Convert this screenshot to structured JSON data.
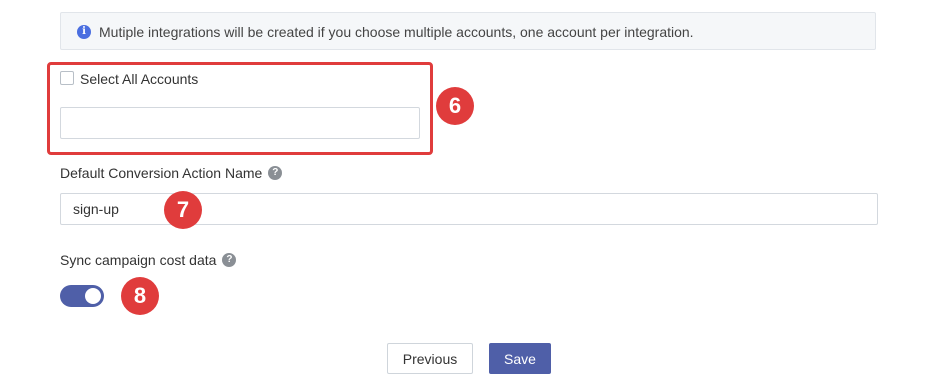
{
  "info_banner": {
    "icon": "info-icon",
    "icon_glyph": "i",
    "text": "Mutiple integrations will be created if you choose multiple accounts, one account per integration."
  },
  "accounts": {
    "select_all_label": "Select All Accounts",
    "select_all_checked": false,
    "input_value": "",
    "marker": "6"
  },
  "conversion": {
    "label": "Default Conversion Action Name",
    "help_glyph": "?",
    "value": "sign-up",
    "marker": "7"
  },
  "sync_cost": {
    "label": "Sync campaign cost data",
    "help_glyph": "?",
    "enabled": true,
    "marker": "8"
  },
  "buttons": {
    "previous_label": "Previous",
    "save_label": "Save"
  },
  "colors": {
    "accent": "#4f5fa8",
    "marker_red": "#e03c3c",
    "info_blue": "#4a6ee0"
  }
}
